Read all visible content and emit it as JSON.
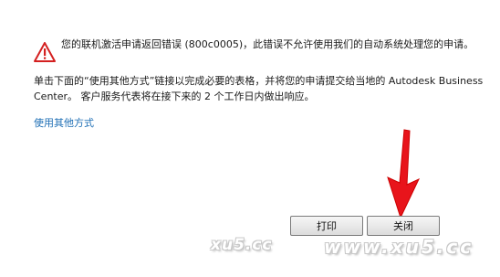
{
  "message": {
    "line1": "您的联机激活申请返回错误 (800c0005)，此错误不允许使用我们的自动系统处理您的申请。",
    "line2": "单击下面的“使用其他方式”链接以完成必要的表格，并将您的申请提交给当地的 Autodesk Business Center。 客户服务代表将在接下来的 2 个工作日内做出响应。"
  },
  "link": {
    "label": "使用其他方式"
  },
  "buttons": {
    "print": "打印",
    "close": "关闭"
  },
  "watermark": {
    "left": "xu5.cc",
    "right": "www.xu5.cc"
  },
  "icons": {
    "warning": "warning-triangle-icon",
    "arrow": "red-down-arrow-icon"
  },
  "colors": {
    "link": "#1f6fb5",
    "warning": "#d42020",
    "arrow": "#e8141b"
  }
}
